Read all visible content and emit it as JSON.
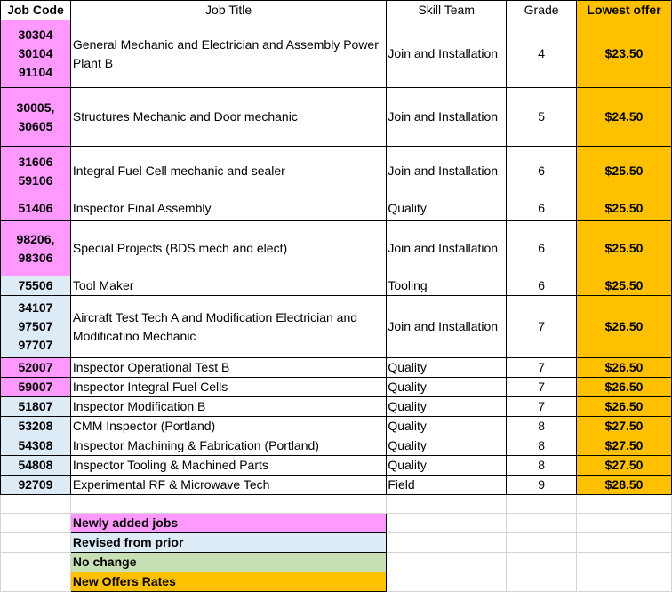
{
  "headers": {
    "job_code": "Job Code",
    "job_title": "Job Title",
    "skill_team": "Skill Team",
    "grade": "Grade",
    "lowest_offer": "Lowest offer"
  },
  "rows": [
    {
      "codes": [
        "30304",
        "30104",
        "91104"
      ],
      "title": "General Mechanic and Electrician and  Assembly Power Plant B",
      "team": "Join and Installation",
      "grade": "4",
      "offer": "$23.50",
      "status": "new"
    },
    {
      "codes": [
        "30005,",
        "30605"
      ],
      "title": "Structures Mechanic and Door mechanic",
      "team": "Join and Installation",
      "grade": "5",
      "offer": "$24.50",
      "status": "new"
    },
    {
      "codes": [
        "31606",
        "59106"
      ],
      "title": "Integral Fuel Cell mechanic and sealer",
      "team": "Join and Installation",
      "grade": "6",
      "offer": "$25.50",
      "status": "new"
    },
    {
      "codes": [
        "51406"
      ],
      "title": "Inspector Final Assembly",
      "team": "Quality",
      "grade": "6",
      "offer": "$25.50",
      "status": "new"
    },
    {
      "codes": [
        "98206,",
        "98306"
      ],
      "title": "Special Projects (BDS mech and elect)",
      "team": "Join and Installation",
      "grade": "6",
      "offer": "$25.50",
      "status": "new"
    },
    {
      "codes": [
        "75506"
      ],
      "title": "Tool Maker",
      "team": "Tooling",
      "grade": "6",
      "offer": "$25.50",
      "status": "revised"
    },
    {
      "codes": [
        "34107",
        "97507",
        "97707"
      ],
      "title": "Aircraft Test Tech A and Modification Electrician and Modificatino Mechanic",
      "team": "Join and Installation",
      "grade": "7",
      "offer": "$26.50",
      "status": "revised"
    },
    {
      "codes": [
        "52007"
      ],
      "title": "Inspector Operational Test B",
      "team": "Quality",
      "grade": "7",
      "offer": "$26.50",
      "status": "new"
    },
    {
      "codes": [
        "59007"
      ],
      "title": "Inspector Integral Fuel Cells",
      "team": "Quality",
      "grade": "7",
      "offer": "$26.50",
      "status": "new"
    },
    {
      "codes": [
        "51807"
      ],
      "title": "Inspector Modification B",
      "team": "Quality",
      "grade": "7",
      "offer": "$26.50",
      "status": "revised"
    },
    {
      "codes": [
        "53208"
      ],
      "title": "CMM Inspector (Portland)",
      "team": "Quality",
      "grade": "8",
      "offer": "$27.50",
      "status": "revised"
    },
    {
      "codes": [
        "54308"
      ],
      "title": "Inspector Machining & Fabrication (Portland)",
      "team": "Quality",
      "grade": "8",
      "offer": "$27.50",
      "status": "revised"
    },
    {
      "codes": [
        "54808"
      ],
      "title": "Inspector Tooling & Machined Parts",
      "team": "Quality",
      "grade": "8",
      "offer": "$27.50",
      "status": "revised"
    },
    {
      "codes": [
        "92709"
      ],
      "title": "Experimental RF & Microwave Tech",
      "team": "Field",
      "grade": "9",
      "offer": "$28.50",
      "status": "revised"
    }
  ],
  "legend": [
    {
      "label": "Newly added jobs",
      "color": "#ff99ff"
    },
    {
      "label": "Revised from prior",
      "color": "#ddebf7"
    },
    {
      "label": "No change",
      "color": "#c6e0b4"
    },
    {
      "label": "New Offers Rates",
      "color": "#ffc000"
    }
  ],
  "colors": {
    "new": "#ff99ff",
    "revised": "#ddebf7",
    "no_change": "#c6e0b4",
    "offer": "#ffc000"
  }
}
